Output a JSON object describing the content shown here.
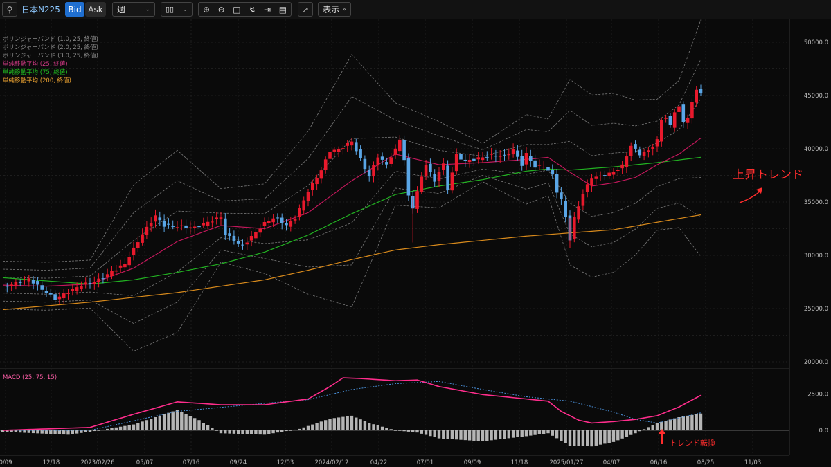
{
  "toolbar": {
    "symbol": "日本N225",
    "bid_label": "Bid",
    "ask_label": "Ask",
    "interval": "週",
    "view_label": "表示"
  },
  "colors": {
    "up": "#e8192c",
    "down": "#5aa6e6",
    "sma25": "#c2185b",
    "sma75": "#22b322",
    "sma200": "#d88a1c",
    "bollinger": "#7a7a7a",
    "macd": "#ff2d8c",
    "signal": "#4a90d9",
    "histogram": "#b5b5b5",
    "annotation": "#ff2d2d"
  },
  "legends": [
    {
      "text": "ボリンジャーバンド (1.0, 25, 終値)",
      "color": "#8a8a8a"
    },
    {
      "text": "ボリンジャーバンド (2.0, 25, 終値)",
      "color": "#8a8a8a"
    },
    {
      "text": "ボリンジャーバンド (3.0, 25, 終値)",
      "color": "#8a8a8a"
    },
    {
      "text": "単純移動平均 (25, 終値)",
      "color": "#d23a86"
    },
    {
      "text": "単純移動平均 (75, 終値)",
      "color": "#22c322"
    },
    {
      "text": "単純移動平均 (200, 終値)",
      "color": "#e8a030"
    }
  ],
  "macd_legend": "MACD (25, 75, 15)",
  "annotations": {
    "uptrend": "上昇トレンド",
    "reversal": "トレンド転換"
  },
  "chart_data": {
    "type": "candlestick",
    "x_ticks": [
      "0/09",
      "12/18",
      "2023/02/26",
      "05/07",
      "07/16",
      "09/24",
      "12/03",
      "2024/02/12",
      "04/22",
      "07/01",
      "09/09",
      "11/18",
      "2025/01/27",
      "04/07",
      "06/16",
      "08/25",
      "11/03"
    ],
    "price_axis": {
      "ticks": [
        "20000.0",
        "25000.0",
        "30000.0",
        "35000.0",
        "40000.0",
        "45000.0",
        "50000.0"
      ],
      "ylim": [
        19900,
        52000
      ]
    },
    "macd_axis": {
      "ticks": [
        "0.0",
        "2500.0"
      ]
    },
    "close_path": [
      [
        0,
        27000
      ],
      [
        6,
        27800
      ],
      [
        9,
        26800
      ],
      [
        12,
        25900
      ],
      [
        18,
        27200
      ],
      [
        22,
        27700
      ],
      [
        28,
        29200
      ],
      [
        32,
        32000
      ],
      [
        35,
        33700
      ],
      [
        37,
        32800
      ],
      [
        44,
        32600
      ],
      [
        50,
        33600
      ],
      [
        51,
        32000
      ],
      [
        54,
        31100
      ],
      [
        55,
        30900
      ],
      [
        60,
        33000
      ],
      [
        62,
        33500
      ],
      [
        63,
        33400
      ],
      [
        65,
        32800
      ],
      [
        67,
        33500
      ],
      [
        70,
        36000
      ],
      [
        73,
        38000
      ],
      [
        75,
        39800
      ],
      [
        77,
        39900
      ],
      [
        80,
        40700
      ],
      [
        82,
        39000
      ],
      [
        84,
        37400
      ],
      [
        86,
        39300
      ],
      [
        88,
        38500
      ],
      [
        89,
        39300
      ],
      [
        90,
        39900
      ],
      [
        91,
        40900
      ],
      [
        92,
        39000
      ],
      [
        93,
        35500
      ],
      [
        94,
        34500
      ],
      [
        95,
        36000
      ],
      [
        97,
        38600
      ],
      [
        99,
        36900
      ],
      [
        100,
        37900
      ],
      [
        101,
        38500
      ],
      [
        102,
        36200
      ],
      [
        104,
        39400
      ],
      [
        106,
        38800
      ],
      [
        109,
        39100
      ],
      [
        112,
        39400
      ],
      [
        115,
        39300
      ],
      [
        117,
        39900
      ],
      [
        119,
        38500
      ],
      [
        120,
        39500
      ],
      [
        122,
        38300
      ],
      [
        124,
        38400
      ],
      [
        126,
        37500
      ],
      [
        127,
        36000
      ],
      [
        128,
        35200
      ],
      [
        129,
        33600
      ],
      [
        130,
        31500
      ],
      [
        131,
        33500
      ],
      [
        133,
        35800
      ],
      [
        135,
        37300
      ],
      [
        137,
        37400
      ],
      [
        140,
        37800
      ],
      [
        142,
        38400
      ],
      [
        144,
        40300
      ],
      [
        146,
        39500
      ],
      [
        148,
        39800
      ],
      [
        150,
        40800
      ],
      [
        151,
        42700
      ],
      [
        152,
        43000
      ],
      [
        153,
        42100
      ],
      [
        154,
        43500
      ],
      [
        155,
        44000
      ],
      [
        156,
        42400
      ],
      [
        157,
        43000
      ],
      [
        158,
        44300
      ],
      [
        159,
        45500
      ],
      [
        160,
        45300
      ]
    ],
    "sma25_path": [
      [
        0,
        27200
      ],
      [
        10,
        27100
      ],
      [
        20,
        27300
      ],
      [
        30,
        28800
      ],
      [
        40,
        31300
      ],
      [
        50,
        32800
      ],
      [
        60,
        32500
      ],
      [
        70,
        34000
      ],
      [
        80,
        37000
      ],
      [
        90,
        39500
      ],
      [
        95,
        39000
      ],
      [
        100,
        38500
      ],
      [
        110,
        38700
      ],
      [
        120,
        39000
      ],
      [
        125,
        39200
      ],
      [
        130,
        37800
      ],
      [
        135,
        36500
      ],
      [
        140,
        36800
      ],
      [
        145,
        37300
      ],
      [
        150,
        38500
      ],
      [
        155,
        39500
      ],
      [
        160,
        41000
      ]
    ],
    "sma75_path": [
      [
        0,
        27900
      ],
      [
        10,
        27600
      ],
      [
        20,
        27300
      ],
      [
        30,
        27700
      ],
      [
        40,
        28400
      ],
      [
        50,
        29200
      ],
      [
        60,
        30300
      ],
      [
        70,
        31900
      ],
      [
        80,
        33900
      ],
      [
        90,
        35700
      ],
      [
        100,
        36500
      ],
      [
        110,
        37100
      ],
      [
        120,
        37900
      ],
      [
        125,
        38100
      ],
      [
        130,
        38000
      ],
      [
        140,
        38300
      ],
      [
        150,
        38700
      ],
      [
        160,
        39200
      ]
    ],
    "sma200_path": [
      [
        0,
        24900
      ],
      [
        20,
        25600
      ],
      [
        40,
        26500
      ],
      [
        60,
        27700
      ],
      [
        70,
        28600
      ],
      [
        80,
        29600
      ],
      [
        90,
        30500
      ],
      [
        100,
        31000
      ],
      [
        110,
        31400
      ],
      [
        120,
        31800
      ],
      [
        130,
        32100
      ],
      [
        140,
        32400
      ],
      [
        150,
        33100
      ],
      [
        160,
        33800
      ]
    ],
    "bollinger_2sd_width": [
      [
        0,
        1500
      ],
      [
        20,
        1500
      ],
      [
        30,
        5200
      ],
      [
        40,
        5700
      ],
      [
        50,
        2300
      ],
      [
        60,
        2800
      ],
      [
        70,
        5100
      ],
      [
        80,
        7900
      ],
      [
        90,
        3200
      ],
      [
        100,
        2700
      ],
      [
        110,
        1200
      ],
      [
        120,
        2800
      ],
      [
        125,
        2400
      ],
      [
        130,
        5800
      ],
      [
        140,
        5600
      ],
      [
        150,
        4100
      ],
      [
        155,
        4600
      ],
      [
        160,
        7400
      ]
    ],
    "macd_path": [
      [
        0,
        0
      ],
      [
        10,
        100
      ],
      [
        20,
        200
      ],
      [
        30,
        1100
      ],
      [
        40,
        1950
      ],
      [
        50,
        1750
      ],
      [
        60,
        1750
      ],
      [
        70,
        2150
      ],
      [
        75,
        3000
      ],
      [
        78,
        3600
      ],
      [
        82,
        3550
      ],
      [
        90,
        3400
      ],
      [
        95,
        3450
      ],
      [
        100,
        3000
      ],
      [
        110,
        2450
      ],
      [
        120,
        2150
      ],
      [
        125,
        2000
      ],
      [
        128,
        1300
      ],
      [
        132,
        700
      ],
      [
        135,
        500
      ],
      [
        140,
        600
      ],
      [
        145,
        750
      ],
      [
        150,
        1000
      ],
      [
        155,
        1600
      ],
      [
        160,
        2400
      ]
    ],
    "signal_path": [
      [
        0,
        0
      ],
      [
        20,
        0
      ],
      [
        40,
        1300
      ],
      [
        60,
        1850
      ],
      [
        70,
        2100
      ],
      [
        80,
        2800
      ],
      [
        90,
        3200
      ],
      [
        100,
        3350
      ],
      [
        110,
        2800
      ],
      [
        120,
        2300
      ],
      [
        130,
        2000
      ],
      [
        140,
        1250
      ],
      [
        145,
        750
      ],
      [
        150,
        500
      ],
      [
        155,
        850
      ],
      [
        160,
        1200
      ]
    ],
    "histogram_path": [
      [
        0,
        -100
      ],
      [
        15,
        -300
      ],
      [
        20,
        -100
      ],
      [
        30,
        400
      ],
      [
        40,
        1400
      ],
      [
        45,
        700
      ],
      [
        50,
        -200
      ],
      [
        60,
        -300
      ],
      [
        68,
        100
      ],
      [
        75,
        800
      ],
      [
        80,
        1000
      ],
      [
        84,
        500
      ],
      [
        90,
        0
      ],
      [
        95,
        -150
      ],
      [
        100,
        -550
      ],
      [
        110,
        -750
      ],
      [
        120,
        -400
      ],
      [
        125,
        -200
      ],
      [
        130,
        -1050
      ],
      [
        135,
        -1100
      ],
      [
        140,
        -800
      ],
      [
        145,
        -200
      ],
      [
        150,
        500
      ],
      [
        155,
        900
      ],
      [
        160,
        1150
      ]
    ]
  }
}
